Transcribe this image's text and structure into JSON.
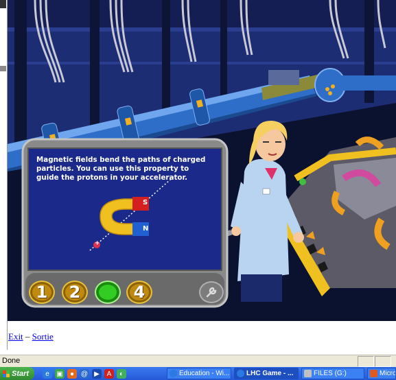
{
  "game": {
    "panel_message": "Magnetic fields bend the paths of charged particles. You can use this property to guide the protons in your accelerator.",
    "magnet_labels": {
      "north": "N",
      "south": "S"
    },
    "particle_label": "+",
    "step_buttons": [
      {
        "label": "1",
        "state": "inactive"
      },
      {
        "label": "2",
        "state": "inactive"
      },
      {
        "label": "",
        "state": "active"
      },
      {
        "label": "4",
        "state": "inactive"
      }
    ],
    "tool_icon": "wrench-icon",
    "colors": {
      "panel_bg": "#1b2a8a",
      "panel_frame": "#8a8a8a",
      "button_gold": "#c08a10",
      "button_active": "#33cc22",
      "pipe_blue": "#2e6ec8"
    }
  },
  "links": {
    "exit": "Exit",
    "separator": "–",
    "sortie": "Sortie"
  },
  "statusbar": {
    "text": "Done"
  },
  "taskbar": {
    "start_label": "Start",
    "quicklaunch": [
      "ie-icon",
      "show-desktop-icon",
      "firefox-icon",
      "outlook-icon",
      "media-player-icon",
      "acrobat-icon",
      "app-icon"
    ],
    "items": [
      {
        "label": "Education - Wi...",
        "icon": "ie-icon",
        "active": false
      },
      {
        "label": "LHC Game - ...",
        "icon": "ie-icon",
        "active": true
      },
      {
        "label": "FILES (G:)",
        "icon": "drive-icon",
        "active": false
      },
      {
        "label": "Micro",
        "icon": "office-icon",
        "active": false
      }
    ]
  }
}
